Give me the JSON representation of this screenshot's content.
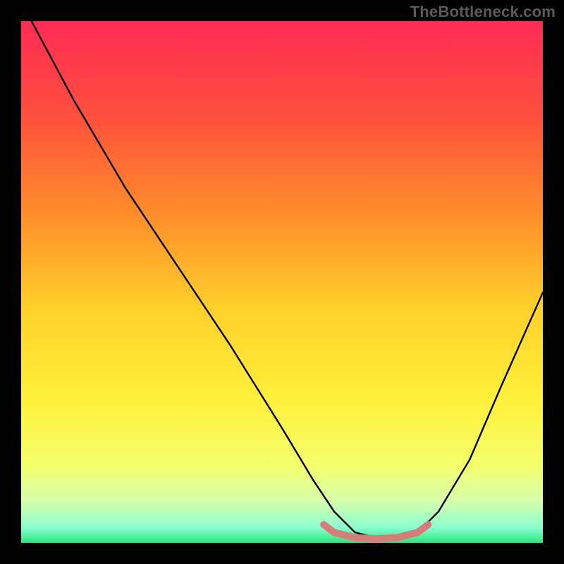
{
  "watermark": "TheBottleneck.com",
  "chart_data": {
    "type": "line",
    "title": "",
    "xlabel": "",
    "ylabel": "",
    "xlim": [
      0,
      100
    ],
    "ylim": [
      0,
      100
    ],
    "grid": false,
    "legend": false,
    "gradient_stops": [
      {
        "offset": 0.0,
        "color": "#ff2b55"
      },
      {
        "offset": 0.18,
        "color": "#ff4f3d"
      },
      {
        "offset": 0.36,
        "color": "#ff8a2a"
      },
      {
        "offset": 0.55,
        "color": "#ffd02a"
      },
      {
        "offset": 0.72,
        "color": "#ffef3a"
      },
      {
        "offset": 0.85,
        "color": "#f4ff6a"
      },
      {
        "offset": 0.92,
        "color": "#d6ffab"
      },
      {
        "offset": 0.97,
        "color": "#8bffd0"
      },
      {
        "offset": 1.0,
        "color": "#27e77a"
      }
    ],
    "series": [
      {
        "name": "bottleneck-curve",
        "x": [
          2,
          10,
          20,
          30,
          40,
          50,
          56,
          60,
          64,
          68,
          72,
          76,
          80,
          86,
          92,
          100
        ],
        "y": [
          100,
          85,
          68,
          53,
          38,
          22,
          12,
          6,
          2,
          1,
          1,
          2,
          6,
          16,
          30,
          48
        ]
      }
    ],
    "highlight_band": {
      "name": "optimal-range",
      "color": "#d97b78",
      "x": [
        58,
        60,
        64,
        68,
        72,
        76,
        78
      ],
      "y": [
        3.5,
        2.0,
        1.0,
        0.8,
        1.0,
        2.0,
        3.5
      ]
    }
  }
}
